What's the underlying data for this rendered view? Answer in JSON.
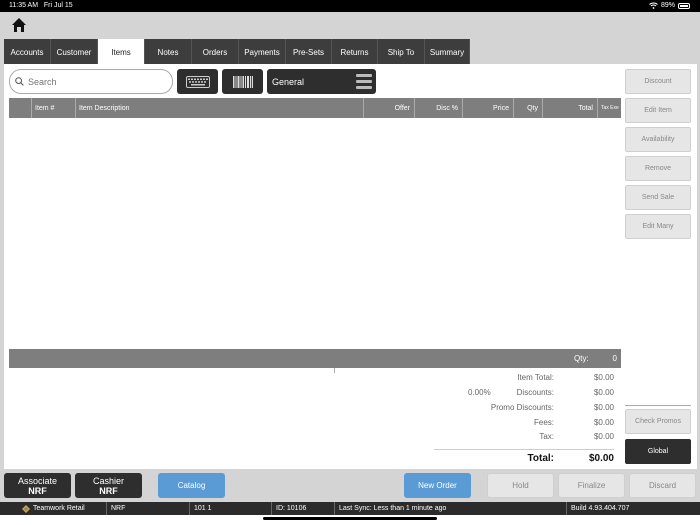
{
  "status": {
    "time": "11:35 AM",
    "date": "Fri Jul 15",
    "battery": "89%"
  },
  "tabs": [
    {
      "label": "Accounts"
    },
    {
      "label": "Customer"
    },
    {
      "label": "Items"
    },
    {
      "label": "Notes"
    },
    {
      "label": "Orders"
    },
    {
      "label": "Payments"
    },
    {
      "label": "Pre-Sets"
    },
    {
      "label": "Returns"
    },
    {
      "label": "Ship To"
    },
    {
      "label": "Summary"
    }
  ],
  "active_tab": "Items",
  "search": {
    "placeholder": "Search"
  },
  "category": {
    "selected": "General"
  },
  "grid": {
    "columns": [
      "Item #",
      "Item Description",
      "Offer",
      "Disc %",
      "Price",
      "Qty",
      "Total",
      "Tax Exe"
    ]
  },
  "qty_bar": {
    "label": "Qty:",
    "value": "0"
  },
  "summary": {
    "item_total": {
      "label": "Item Total:",
      "value": "$0.00"
    },
    "discounts": {
      "pct": "0.00%",
      "label": "Discounts:",
      "value": "$0.00"
    },
    "promo_discounts": {
      "label": "Promo Discounts:",
      "value": "$0.00"
    },
    "fees": {
      "label": "Fees:",
      "value": "$0.00"
    },
    "tax": {
      "label": "Tax:",
      "value": "$0.00"
    },
    "total": {
      "label": "Total:",
      "value": "$0.00"
    }
  },
  "side_buttons": {
    "discount": "Discount",
    "edit_item": "Edit Item",
    "availability": "Availability",
    "remove": "Remove",
    "send_sale": "Send Sale",
    "edit_many": "Edit Many",
    "check_promos": "Check Promos",
    "global": "Global"
  },
  "bottom": {
    "associate_label": "Associate",
    "associate_value": "NRF",
    "cashier_label": "Cashier",
    "cashier_value": "NRF",
    "catalog": "Catalog",
    "new_order": "New Order",
    "hold": "Hold",
    "finalize": "Finalize",
    "discard": "Discard"
  },
  "footer": {
    "brand": "Teamwork Retail",
    "location": "NRF",
    "register": "101 1",
    "id": "ID: 10106",
    "last_sync": "Last Sync: Less than 1 minute ago",
    "build": "Build 4.93.404.707"
  },
  "colors": {
    "tab_dark": "#3d3d3d",
    "header_gray": "#7e7e7e",
    "blue_button": "#5b9bd5",
    "dark_button": "#2e2e2e"
  }
}
